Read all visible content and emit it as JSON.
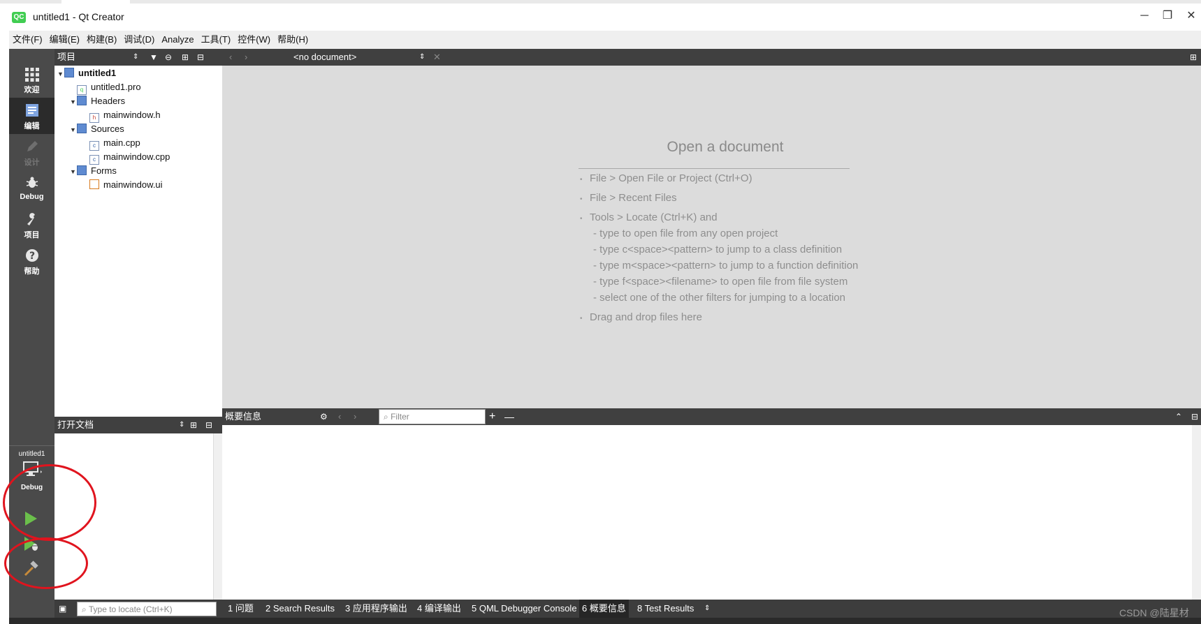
{
  "window": {
    "title": "untitled1 - Qt Creator",
    "logo": "QC",
    "minimize_icon": "─",
    "restore_icon": "❐",
    "close_icon": "✕"
  },
  "menu": [
    "文件(F)",
    "编辑(E)",
    "构建(B)",
    "调试(D)",
    "Analyze",
    "工具(T)",
    "控件(W)",
    "帮助(H)"
  ],
  "modes": [
    {
      "label": "欢迎",
      "icon": "grid-icon"
    },
    {
      "label": "编辑",
      "icon": "edit-icon"
    },
    {
      "label": "设计",
      "icon": "pencil-icon"
    },
    {
      "label": "Debug",
      "icon": "bug-icon"
    },
    {
      "label": "项目",
      "icon": "wrench-icon"
    },
    {
      "label": "帮助",
      "icon": "help-icon"
    }
  ],
  "target": {
    "project": "untitled1",
    "build": "Debug"
  },
  "projects_pane": {
    "title": "项目",
    "tree": [
      {
        "label": "untitled1",
        "level": 0,
        "type": "project",
        "expanded": true
      },
      {
        "label": "untitled1.pro",
        "level": 1,
        "type": "pro"
      },
      {
        "label": "Headers",
        "level": 1,
        "type": "folder",
        "expanded": true
      },
      {
        "label": "mainwindow.h",
        "level": 2,
        "type": "h"
      },
      {
        "label": "Sources",
        "level": 1,
        "type": "folder",
        "expanded": true
      },
      {
        "label": "main.cpp",
        "level": 2,
        "type": "cpp"
      },
      {
        "label": "mainwindow.cpp",
        "level": 2,
        "type": "cpp"
      },
      {
        "label": "Forms",
        "level": 1,
        "type": "folder",
        "expanded": true
      },
      {
        "label": "mainwindow.ui",
        "level": 2,
        "type": "ui"
      }
    ]
  },
  "open_documents_pane": {
    "title": "打开文档"
  },
  "editor": {
    "document_selector": "<no document>",
    "welcome_title": "Open a document",
    "hints": [
      {
        "text": "File > Open File or Project (Ctrl+O)",
        "bullet": true
      },
      {
        "text": "File > Recent Files",
        "bullet": true
      },
      {
        "text": "Tools > Locate (Ctrl+K) and",
        "bullet": true
      },
      {
        "text": "- type to open file from any open project",
        "bullet": false
      },
      {
        "text": "- type c<space><pattern> to jump to a class definition",
        "bullet": false
      },
      {
        "text": "- type m<space><pattern> to jump to a function definition",
        "bullet": false
      },
      {
        "text": "- type f<space><filename> to open file from file system",
        "bullet": false
      },
      {
        "text": "- select one of the other filters for jumping to a location",
        "bullet": false
      },
      {
        "text": "Drag and drop files here",
        "bullet": true
      }
    ]
  },
  "output_pane": {
    "title": "概要信息",
    "filter_placeholder": "Filter",
    "add_label": "+",
    "remove_label": "—"
  },
  "statusbar": {
    "locate_placeholder": "Type to locate (Ctrl+K)",
    "tabs": [
      {
        "label": "1  问题",
        "active": false
      },
      {
        "label": "2  Search Results",
        "active": false
      },
      {
        "label": "3  应用程序输出",
        "active": false
      },
      {
        "label": "4  编译输出",
        "active": false
      },
      {
        "label": "5  QML Debugger Console",
        "active": false
      },
      {
        "label": "6  概要信息",
        "active": true
      },
      {
        "label": "8  Test Results",
        "active": false
      }
    ],
    "watermark": "CSDN @陆星材"
  }
}
